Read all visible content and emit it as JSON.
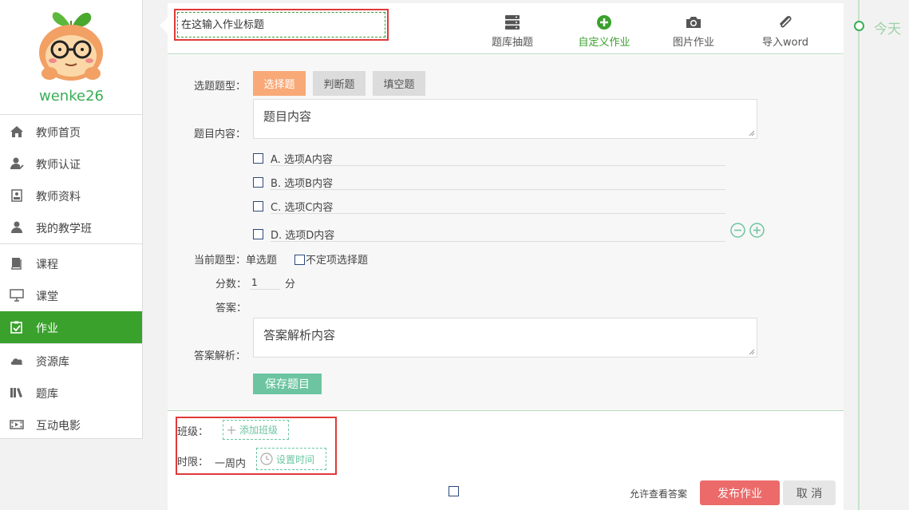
{
  "user": {
    "name": "wenke26"
  },
  "sidebar": {
    "items": [
      {
        "label": "教师首页",
        "icon": "home-icon"
      },
      {
        "label": "教师认证",
        "icon": "user-check-icon"
      },
      {
        "label": "教师资料",
        "icon": "profile-card-icon"
      },
      {
        "label": "我的教学班",
        "icon": "users-icon"
      },
      {
        "label": "课程",
        "icon": "book-icon"
      },
      {
        "label": "课堂",
        "icon": "monitor-icon"
      },
      {
        "label": "作业",
        "icon": "clipboard-check-icon",
        "active": true
      },
      {
        "label": "资源库",
        "icon": "cloud-icon"
      },
      {
        "label": "题库",
        "icon": "library-icon"
      },
      {
        "label": "互动电影",
        "icon": "film-icon"
      }
    ]
  },
  "header": {
    "title_placeholder": "在这输入作业标题",
    "tabs": [
      {
        "label": "题库抽题",
        "icon": "database-icon"
      },
      {
        "label": "自定义作业",
        "icon": "plus-circle-icon",
        "active": true
      },
      {
        "label": "图片作业",
        "icon": "camera-icon"
      },
      {
        "label": "导入word",
        "icon": "paperclip-icon"
      }
    ]
  },
  "form": {
    "type_label": "选题题型：",
    "types": [
      "选择题",
      "判断题",
      "填空题"
    ],
    "content_label": "题目内容：",
    "content_text": "题目内容",
    "options": [
      "A. 选项A内容",
      "B. 选项B内容",
      "C. 选项C内容",
      "D. 选项D内容"
    ],
    "current_type_label": "当前题型：单选题",
    "uncertain_label": "不定项选择题",
    "score_label": "分数：",
    "score_value": "1",
    "score_unit": "分",
    "answer_label": "答案：",
    "analysis_label": "答案解析：",
    "analysis_text": "答案解析内容",
    "save_label": "保存题目"
  },
  "footer": {
    "class_label": "班级：",
    "add_class": "添加班级",
    "deadline_label": "时限：",
    "deadline_value": "一周内",
    "set_time": "设置时间",
    "allow_label": "允许查看答案",
    "publish_label": "发布作业",
    "cancel_label": "取 消"
  },
  "timeline": {
    "label": "今天"
  },
  "colors": {
    "accent_green": "#3aa12c",
    "orange": "#f8a977",
    "publish_red": "#ec6a6a",
    "teal": "#6cc5a0"
  }
}
